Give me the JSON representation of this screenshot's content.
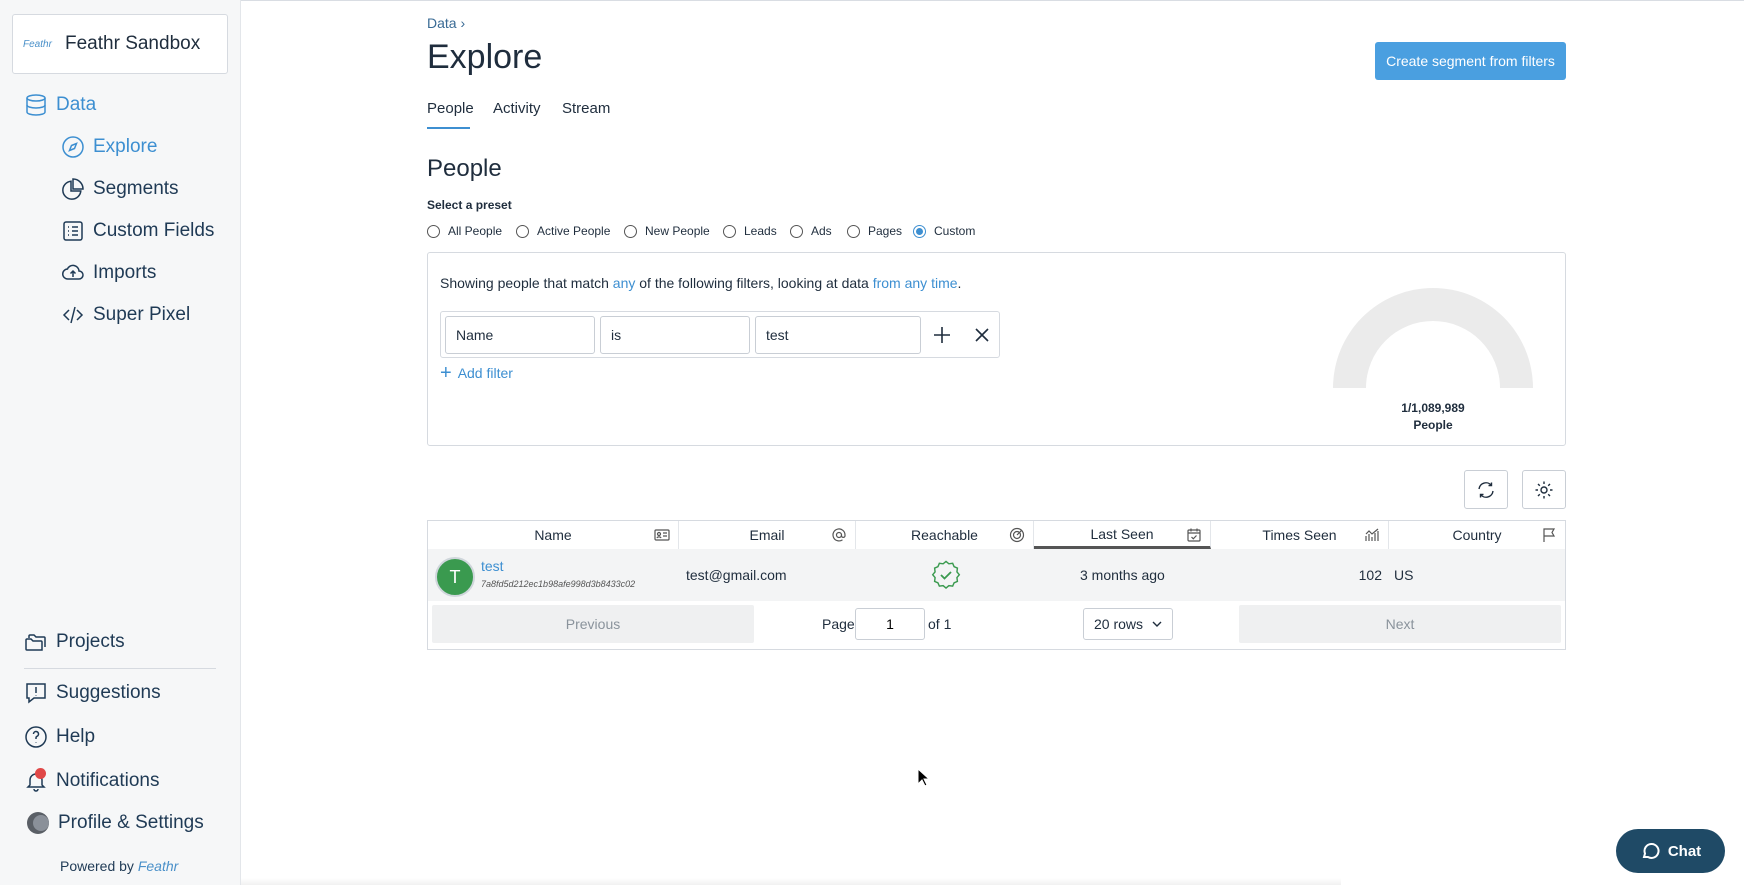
{
  "sidebar": {
    "account_logo": "Feathr",
    "account_name": "Feathr Sandbox",
    "data_label": "Data",
    "items": [
      {
        "label": "Explore"
      },
      {
        "label": "Segments"
      },
      {
        "label": "Custom Fields"
      },
      {
        "label": "Imports"
      },
      {
        "label": "Super Pixel"
      }
    ],
    "bottom_items": [
      {
        "label": "Projects"
      },
      {
        "label": "Suggestions"
      },
      {
        "label": "Help"
      },
      {
        "label": "Notifications"
      },
      {
        "label": "Profile & Settings"
      }
    ],
    "powered_by": "Powered by",
    "powered_brand": "Feathr"
  },
  "header": {
    "breadcrumb": "Data ›",
    "title": "Explore",
    "create_button": "Create segment from filters",
    "tabs": [
      {
        "label": "People"
      },
      {
        "label": "Activity"
      },
      {
        "label": "Stream"
      }
    ]
  },
  "people": {
    "section_title": "People",
    "preset_label": "Select a preset",
    "presets": [
      {
        "label": "All People"
      },
      {
        "label": "Active People"
      },
      {
        "label": "New People"
      },
      {
        "label": "Leads"
      },
      {
        "label": "Ads"
      },
      {
        "label": "Pages"
      },
      {
        "label": "Custom"
      }
    ],
    "selected_preset": "Custom"
  },
  "filters": {
    "desc_prefix": "Showing people that match ",
    "desc_any": "any",
    "desc_middle": " of the following filters, looking at data ",
    "desc_time": "from any time",
    "desc_suffix": ".",
    "field": "Name",
    "operator": "is",
    "value": "test",
    "add_filter": "Add filter",
    "gauge_count": "1/1,089,989",
    "gauge_unit": "People",
    "gauge_fraction": 1e-06
  },
  "table": {
    "columns": [
      {
        "label": "Name"
      },
      {
        "label": "Email"
      },
      {
        "label": "Reachable"
      },
      {
        "label": "Last Seen"
      },
      {
        "label": "Times Seen"
      },
      {
        "label": "Country"
      }
    ],
    "rows": [
      {
        "initial": "T",
        "name": "test",
        "id": "7a8fd5d212ec1b98afe998d3b8433c02",
        "email": "test@gmail.com",
        "last_seen": "3 months ago",
        "times_seen": "102",
        "country": "US"
      }
    ],
    "pager": {
      "previous": "Previous",
      "page_label": "Page",
      "page_value": "1",
      "of_label": "of 1",
      "rows_label": "20 rows",
      "next": "Next"
    }
  },
  "chat": {
    "label": "Chat"
  },
  "colors": {
    "accent": "#3d8fd1",
    "primary_button": "#4a9fe0",
    "avatar": "#3a9a4f",
    "chat": "#1f4a66"
  }
}
